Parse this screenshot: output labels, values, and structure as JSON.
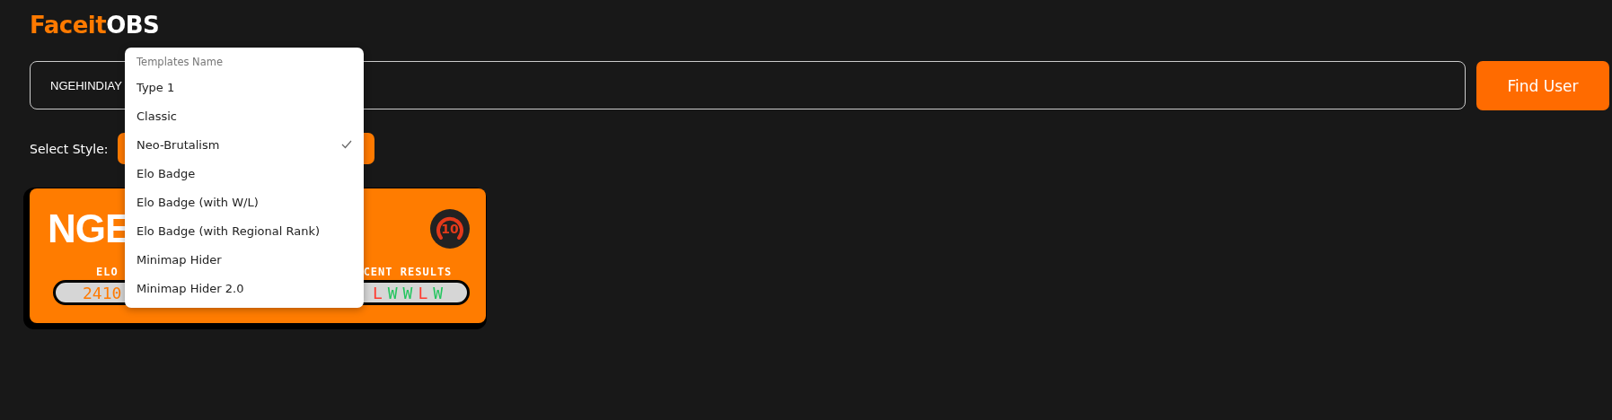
{
  "logo": {
    "part_1": "Faceit",
    "part_2": "OBS"
  },
  "search": {
    "value": "NGEHINDIAY"
  },
  "find_button": "Find User",
  "style_label": "Select Style:",
  "card": {
    "name": "NGE",
    "level_badge": "10",
    "elo_label": "ELO",
    "elo": "2410",
    "results_label": "CENT RESULTS",
    "results": [
      {
        "text": "L",
        "color": "#ff3b30"
      },
      {
        "text": "W",
        "color": "#22c55e"
      },
      {
        "text": "W",
        "color": "#22c55e"
      },
      {
        "text": "L",
        "color": "#ff3b30"
      },
      {
        "text": "W",
        "color": "#22c55e"
      }
    ]
  },
  "menu": {
    "heading": "Templates Name",
    "items": [
      {
        "label": "Type 1",
        "selected": false
      },
      {
        "label": "Classic",
        "selected": false
      },
      {
        "label": "Neo-Brutalism",
        "selected": true
      },
      {
        "label": "Elo Badge",
        "selected": false
      },
      {
        "label": "Elo Badge (with W/L)",
        "selected": false
      },
      {
        "label": "Elo Badge (with Regional Rank)",
        "selected": false
      },
      {
        "label": "Minimap Hider",
        "selected": false
      },
      {
        "label": "Minimap Hider 2.0",
        "selected": false
      }
    ]
  }
}
